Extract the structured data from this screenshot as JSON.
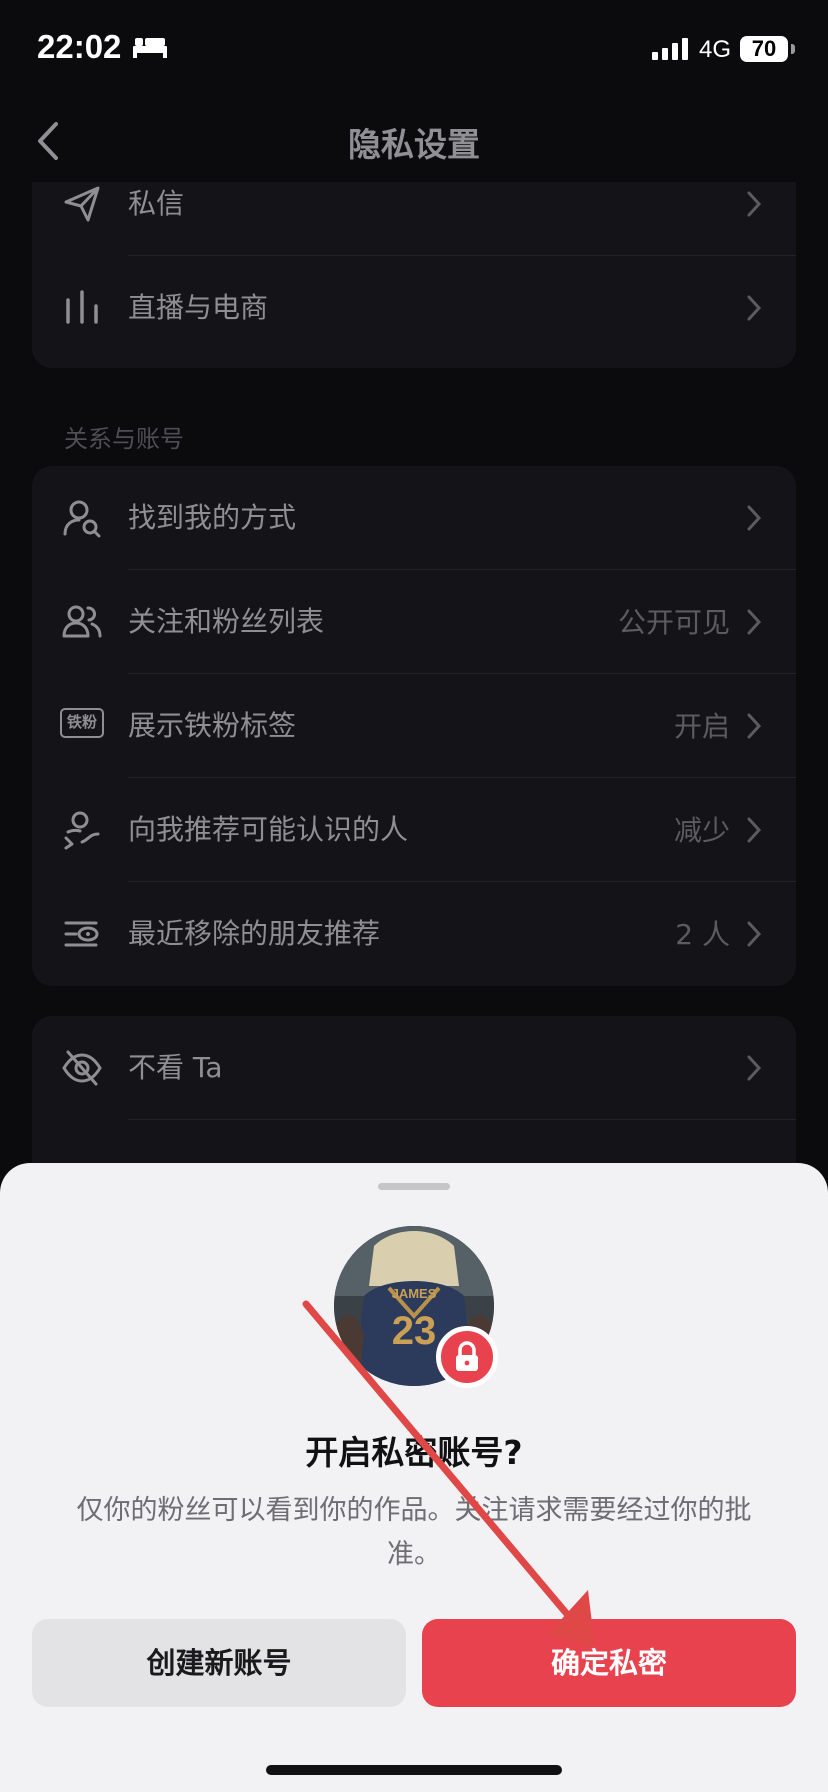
{
  "status_bar": {
    "time": "22:02",
    "network": "4G",
    "battery": "70"
  },
  "nav": {
    "title": "隐私设置"
  },
  "top_card": {
    "items": [
      {
        "label": "私信",
        "icon": "paper-plane-icon",
        "value": ""
      },
      {
        "label": "直播与电商",
        "icon": "bars-icon",
        "value": ""
      }
    ]
  },
  "relations_section": {
    "title": "关系与账号",
    "items": [
      {
        "label": "找到我的方式",
        "icon": "person-search-icon",
        "value": ""
      },
      {
        "label": "关注和粉丝列表",
        "icon": "people-icon",
        "value": "公开可见"
      },
      {
        "label": "展示铁粉标签",
        "icon": "fan-badge-icon",
        "badge_text": "铁粉",
        "value": "开启"
      },
      {
        "label": "向我推荐可能认识的人",
        "icon": "person-link-icon",
        "value": "减少"
      },
      {
        "label": "最近移除的朋友推荐",
        "icon": "list-eye-icon",
        "value": "2 人"
      }
    ]
  },
  "block_card": {
    "items": [
      {
        "label": "不看 Ta",
        "icon": "eye-off-icon",
        "value": ""
      }
    ]
  },
  "sheet": {
    "title": "开启私密账号?",
    "description": "仅你的粉丝可以看到你的作品。关注请求需要经过你的批准。",
    "secondary_button": "创建新账号",
    "primary_button": "确定私密",
    "avatar_jersey_name": "JAMES",
    "avatar_jersey_number": "23"
  },
  "colors": {
    "accent": "#e8424f",
    "annotation_arrow": "#e04848",
    "background": "#0b0b0e",
    "sheet": "#f2f2f4"
  }
}
